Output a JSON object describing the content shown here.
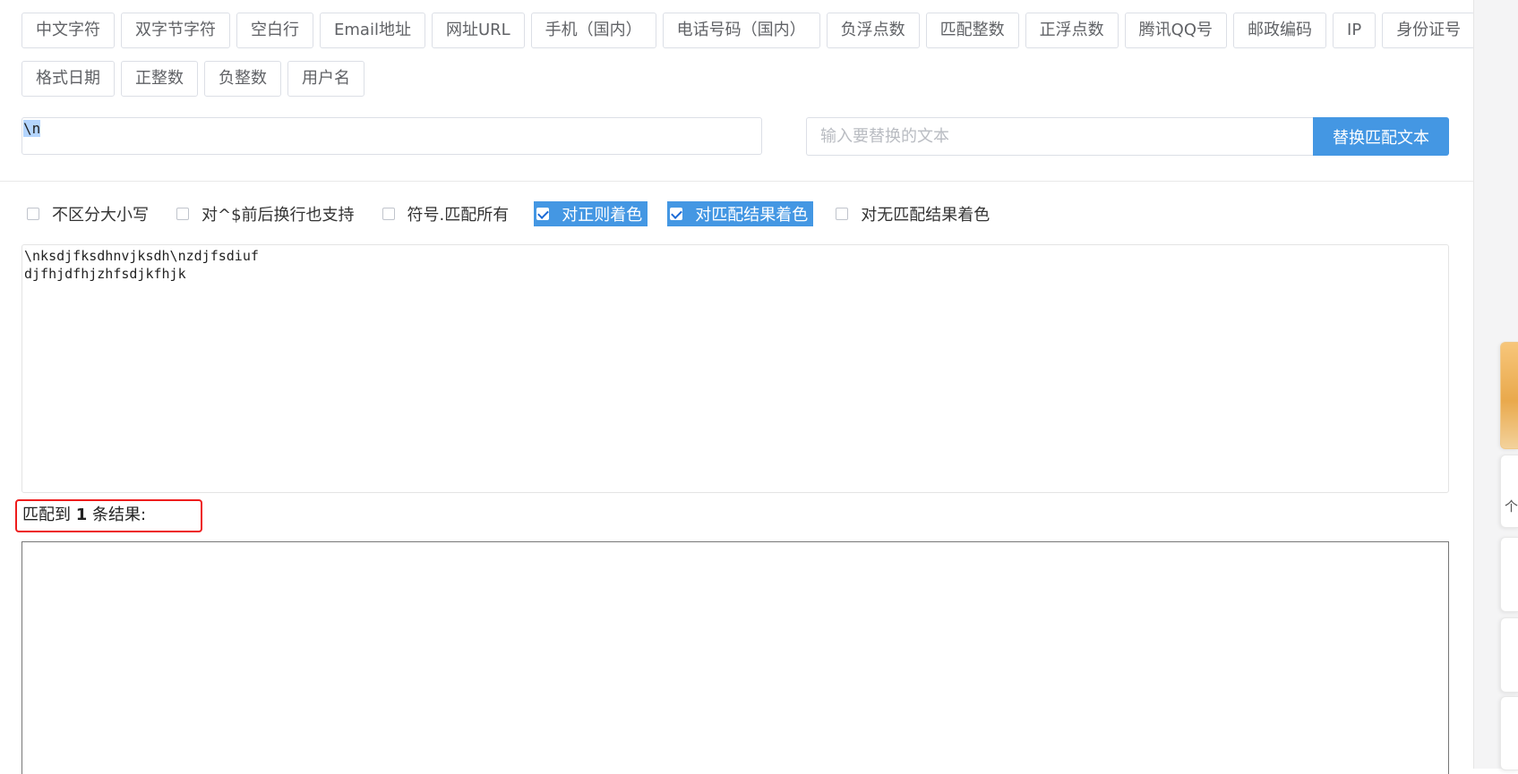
{
  "presets": {
    "row1": [
      "中文字符",
      "双字节字符",
      "空白行",
      "Email地址",
      "网址URL",
      "手机（国内）",
      "电话号码（国内）",
      "负浮点数",
      "匹配整数",
      "正浮点数",
      "腾讯QQ号",
      "邮政编码",
      "IP",
      "身份证号"
    ],
    "row2": [
      "格式日期",
      "正整数",
      "负整数",
      "用户名"
    ]
  },
  "regex": {
    "value": "\\n"
  },
  "replace": {
    "placeholder": "输入要替换的文本",
    "button_label": "替换匹配文本"
  },
  "options": [
    {
      "label": "不区分大小写",
      "checked": false
    },
    {
      "label": "对^$前后换行也支持",
      "checked": false
    },
    {
      "label": "符号.匹配所有",
      "checked": false
    },
    {
      "label": "对正则着色",
      "checked": true
    },
    {
      "label": "对匹配结果着色",
      "checked": true
    },
    {
      "label": "对无匹配结果着色",
      "checked": false
    }
  ],
  "source_text": "\\nksdjfksdhnvjksdh\\nzdjfsdiuf\ndjfhjdfhjzhfsdjkfhjk",
  "result": {
    "prefix": "匹配到 ",
    "count": "1",
    "suffix": " 条结果:"
  },
  "side": {
    "char": "个"
  },
  "colors": {
    "accent": "#4497e3",
    "highlight_border": "#ee1c1c",
    "selection": "#b4d5fe"
  }
}
